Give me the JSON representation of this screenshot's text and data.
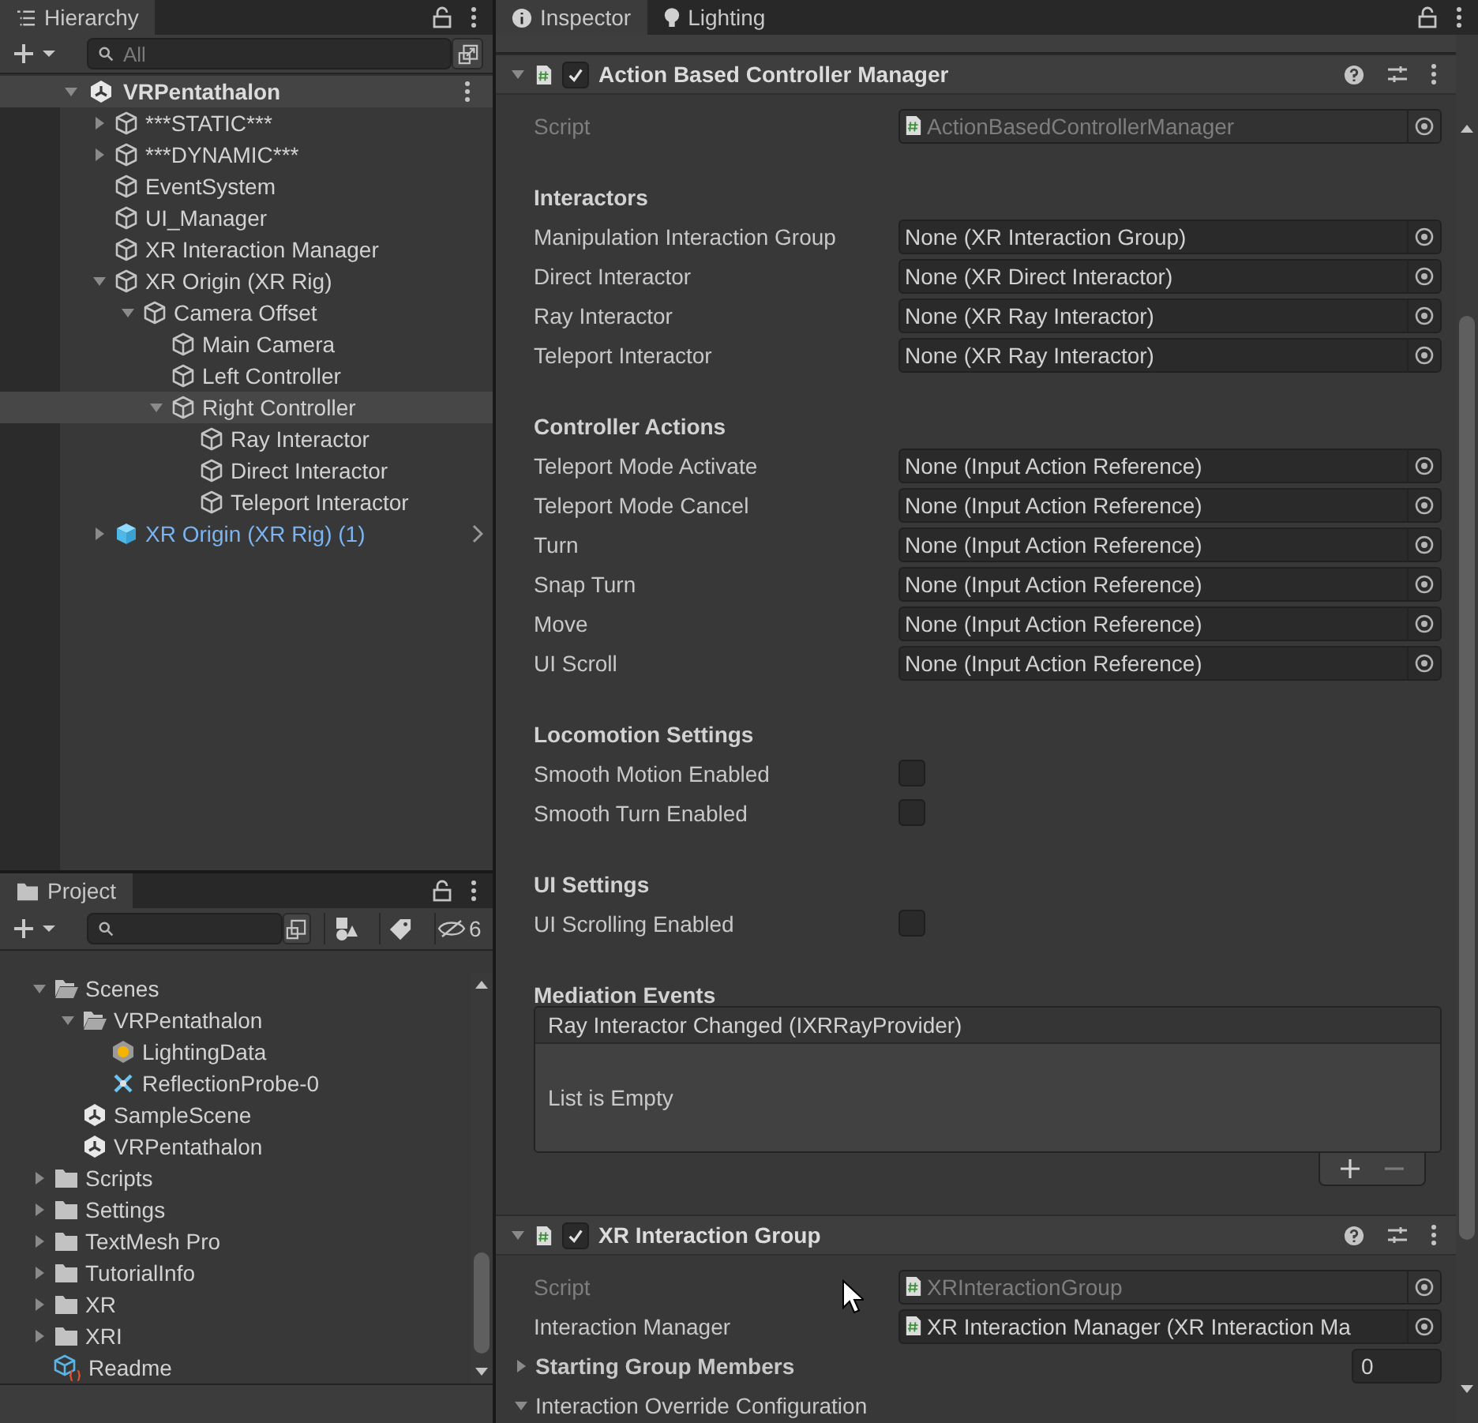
{
  "hierarchy": {
    "title": "Hierarchy",
    "search": {
      "placeholder": "All"
    },
    "scene": {
      "name": "VRPentathalon",
      "expanded": true
    },
    "items": [
      {
        "name": "***STATIC***",
        "kind": "gameobject",
        "expanded": false,
        "selected": false
      },
      {
        "name": "***DYNAMIC***",
        "kind": "gameobject",
        "expanded": false,
        "selected": false
      },
      {
        "name": "EventSystem",
        "kind": "gameobject",
        "selected": false
      },
      {
        "name": "UI_Manager",
        "kind": "gameobject",
        "selected": false
      },
      {
        "name": "XR Interaction Manager",
        "kind": "gameobject",
        "selected": false
      },
      {
        "name": "XR Origin (XR Rig)",
        "kind": "gameobject",
        "expanded": true,
        "selected": false,
        "children": [
          {
            "name": "Camera Offset",
            "kind": "gameobject",
            "expanded": true,
            "selected": false,
            "children": [
              {
                "name": "Main Camera",
                "kind": "gameobject",
                "selected": false
              },
              {
                "name": "Left Controller",
                "kind": "gameobject",
                "selected": false
              },
              {
                "name": "Right Controller",
                "kind": "gameobject",
                "expanded": true,
                "selected": true,
                "children": [
                  {
                    "name": "Ray Interactor",
                    "kind": "gameobject",
                    "selected": false
                  },
                  {
                    "name": "Direct Interactor",
                    "kind": "gameobject",
                    "selected": false
                  },
                  {
                    "name": "Teleport Interactor",
                    "kind": "gameobject",
                    "selected": false
                  }
                ]
              }
            ]
          }
        ]
      },
      {
        "name": "XR Origin (XR Rig) (1)",
        "kind": "prefab",
        "expanded": false,
        "selected": false
      }
    ]
  },
  "project": {
    "title": "Project",
    "hidden_count": "6",
    "items": [
      {
        "name": "Scenes",
        "kind": "folder",
        "expanded": true,
        "selected": false,
        "children": [
          {
            "name": "VRPentathalon",
            "kind": "folder",
            "expanded": true,
            "selected": false,
            "children": [
              {
                "name": "LightingData",
                "kind": "lighting",
                "selected": false
              },
              {
                "name": "ReflectionProbe-0",
                "kind": "probe",
                "selected": false
              }
            ]
          },
          {
            "name": "SampleScene",
            "kind": "scene",
            "selected": false
          },
          {
            "name": "VRPentathalon",
            "kind": "scene",
            "selected": false
          }
        ]
      },
      {
        "name": "Scripts",
        "kind": "folder",
        "expanded": false,
        "selected": false
      },
      {
        "name": "Settings",
        "kind": "folder",
        "expanded": false,
        "selected": false
      },
      {
        "name": "TextMesh Pro",
        "kind": "folder",
        "expanded": false,
        "selected": false
      },
      {
        "name": "TutorialInfo",
        "kind": "folder",
        "expanded": false,
        "selected": false
      },
      {
        "name": "XR",
        "kind": "folder",
        "expanded": false,
        "selected": false
      },
      {
        "name": "XRI",
        "kind": "folder",
        "expanded": false,
        "selected": false
      },
      {
        "name": "Readme",
        "kind": "readme",
        "selected": false
      }
    ]
  },
  "inspector": {
    "tabs": [
      {
        "label": "Inspector",
        "selected": true
      },
      {
        "label": "Lighting",
        "selected": false
      }
    ],
    "components": [
      {
        "title": "Action Based Controller Manager",
        "enabled": true,
        "expanded": true,
        "rows": [
          {
            "kind": "script",
            "label": "Script",
            "value": "ActionBasedControllerManager"
          },
          {
            "kind": "header",
            "label": "Interactors"
          },
          {
            "kind": "object",
            "label": "Manipulation Interaction Group",
            "value": "None (XR Interaction Group)"
          },
          {
            "kind": "object",
            "label": "Direct Interactor",
            "value": "None (XR Direct Interactor)"
          },
          {
            "kind": "object",
            "label": "Ray Interactor",
            "value": "None (XR Ray Interactor)"
          },
          {
            "kind": "object",
            "label": "Teleport Interactor",
            "value": "None (XR Ray Interactor)"
          },
          {
            "kind": "header",
            "label": "Controller Actions"
          },
          {
            "kind": "object",
            "label": "Teleport Mode Activate",
            "value": "None (Input Action Reference)"
          },
          {
            "kind": "object",
            "label": "Teleport Mode Cancel",
            "value": "None (Input Action Reference)"
          },
          {
            "kind": "object",
            "label": "Turn",
            "value": "None (Input Action Reference)"
          },
          {
            "kind": "object",
            "label": "Snap Turn",
            "value": "None (Input Action Reference)"
          },
          {
            "kind": "object",
            "label": "Move",
            "value": "None (Input Action Reference)"
          },
          {
            "kind": "object",
            "label": "UI Scroll",
            "value": "None (Input Action Reference)"
          },
          {
            "kind": "header",
            "label": "Locomotion Settings"
          },
          {
            "kind": "toggle",
            "label": "Smooth Motion Enabled",
            "checked": false
          },
          {
            "kind": "toggle",
            "label": "Smooth Turn Enabled",
            "checked": false
          },
          {
            "kind": "header",
            "label": "UI Settings"
          },
          {
            "kind": "toggle",
            "label": "UI Scrolling Enabled",
            "checked": false
          },
          {
            "kind": "header",
            "label": "Mediation Events"
          },
          {
            "kind": "event_list",
            "title": "Ray Interactor Changed (IXRRayProvider)",
            "empty_text": "List is Empty"
          }
        ]
      },
      {
        "title": "XR Interaction Group",
        "enabled": true,
        "expanded": true,
        "rows": [
          {
            "kind": "script",
            "label": "Script",
            "value": "XRInteractionGroup"
          },
          {
            "kind": "reference",
            "label": "Interaction Manager",
            "value": "XR Interaction Manager (XR Interaction Ma"
          },
          {
            "kind": "foldout",
            "label": "Starting Group Members",
            "expanded": false,
            "count": "0"
          },
          {
            "kind": "foldout",
            "label": "Interaction Override Configuration",
            "expanded": true
          }
        ]
      }
    ]
  }
}
